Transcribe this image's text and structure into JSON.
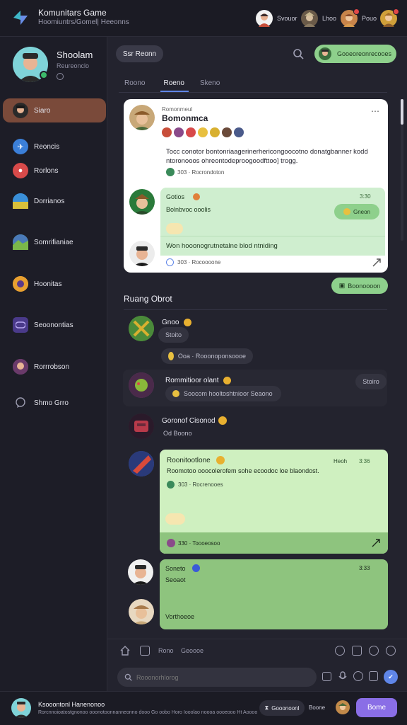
{
  "app": {
    "title": "Komunitars Game",
    "subtitle": "Hoomiuntrs/Gomel| Heeonns"
  },
  "top_users": [
    {
      "name": "Svouor",
      "icon": "avatar-icon",
      "color": "#c84e3a"
    },
    {
      "name": "Lhoo",
      "icon": "avatar-icon",
      "color": "#8a7a62"
    },
    {
      "name": "Pouo",
      "icon": "avatar-icon",
      "color": "#d79a4e"
    },
    {
      "name": "",
      "icon": "avatar-icon",
      "color": "#d0a03a"
    }
  ],
  "sidebar": {
    "profile": {
      "name": "Shoolam",
      "status": "Reureonclo"
    },
    "items": [
      {
        "label": "Siaro",
        "icon": "avatar-icon",
        "color": "#2a2a2a"
      },
      {
        "label": "Reoncis",
        "icon": "plane-icon",
        "color": "#3b7fd8"
      },
      {
        "label": "Rorlons",
        "icon": "flame-icon",
        "color": "#d84a4a"
      },
      {
        "label": "Dorrianos",
        "icon": "globe-icon",
        "color": "#3a8fd8"
      },
      {
        "label": "Somrifianiae",
        "icon": "landscape-icon",
        "color": "#5aa05a"
      },
      {
        "label": "Hoonitas",
        "icon": "avatar-icon",
        "color": "#d88a3a"
      },
      {
        "label": "Seoonontias",
        "icon": "gamepad-icon",
        "color": "#6a5ad8"
      },
      {
        "label": "Rorrrobson",
        "icon": "avatar-icon",
        "color": "#8a4a8a"
      },
      {
        "label": "Shmo Grro",
        "icon": "chat-icon",
        "color": ""
      }
    ]
  },
  "header": {
    "pill": "Ssr Reonn",
    "user_button": "Gooeoreonrecooes"
  },
  "tabs": [
    "Roono",
    "Roeno",
    "Skeno"
  ],
  "post_card": {
    "kicker": "Romonmeul",
    "title": "Bomonmca",
    "body": "Tocc conotor bontonriaagerinerhericongoocotno donatgbanner kodd ntoronooos ohreontodeproogoodfttoo] trogg.",
    "meta": "303 · Rocrondoton",
    "reply_name": "Gotios",
    "reply_time": "3:30",
    "reply_sub": "Bolnbvoc ooolis",
    "reply_badge": "Gneon",
    "reply_text": "Won hooonogrutnetalne blod ntniding",
    "reply_meta": "303 · Rocoooone"
  },
  "section": {
    "title": "Ruang Obrot",
    "button": "Boonoooon"
  },
  "messages": [
    {
      "name": "Gnoo",
      "sub": "Stoito",
      "chip": "Ooa · Rooonoponsoooe"
    },
    {
      "name": "Rommitioor olant",
      "chip": "Soocom hooltoshtnioor  Seaono",
      "side": "Stoiro"
    },
    {
      "name": "Goronof Cisonod",
      "sub": "Od Boono"
    },
    {
      "name": "Roonitootlone",
      "tag": "Heoh",
      "time": "3:36",
      "text": "Roomotoo ooocolerofem sohe ecoodoc loe blaondost.",
      "meta": "303 · Rocrenooes",
      "foot": "330 · Toooeosoo"
    },
    {
      "name": "Soneto",
      "sub": "Seoaot",
      "time": "3:33",
      "foot": "Vorthoeoe"
    }
  ],
  "toolbar": {
    "label_a": "Rono",
    "label_b": "Geoooe"
  },
  "composer": {
    "placeholder": "Rooonorhlorog"
  },
  "footer": {
    "title": "Ksooontonl Hanenonoo",
    "text": "Rorcnnoioatostgnonoo ooonotoonnanneonno dooo Go oobo Horo Iooolao noooa oooeooo Ht Aoooo",
    "pill": "Gooonoonl",
    "label": "Boone",
    "button": "Bome"
  },
  "colors": {
    "accent_green": "#8ed08c",
    "accent_blue": "#5f86e8",
    "active_nav": "#7a4a3a",
    "primary_button": "#8a6ee6"
  }
}
